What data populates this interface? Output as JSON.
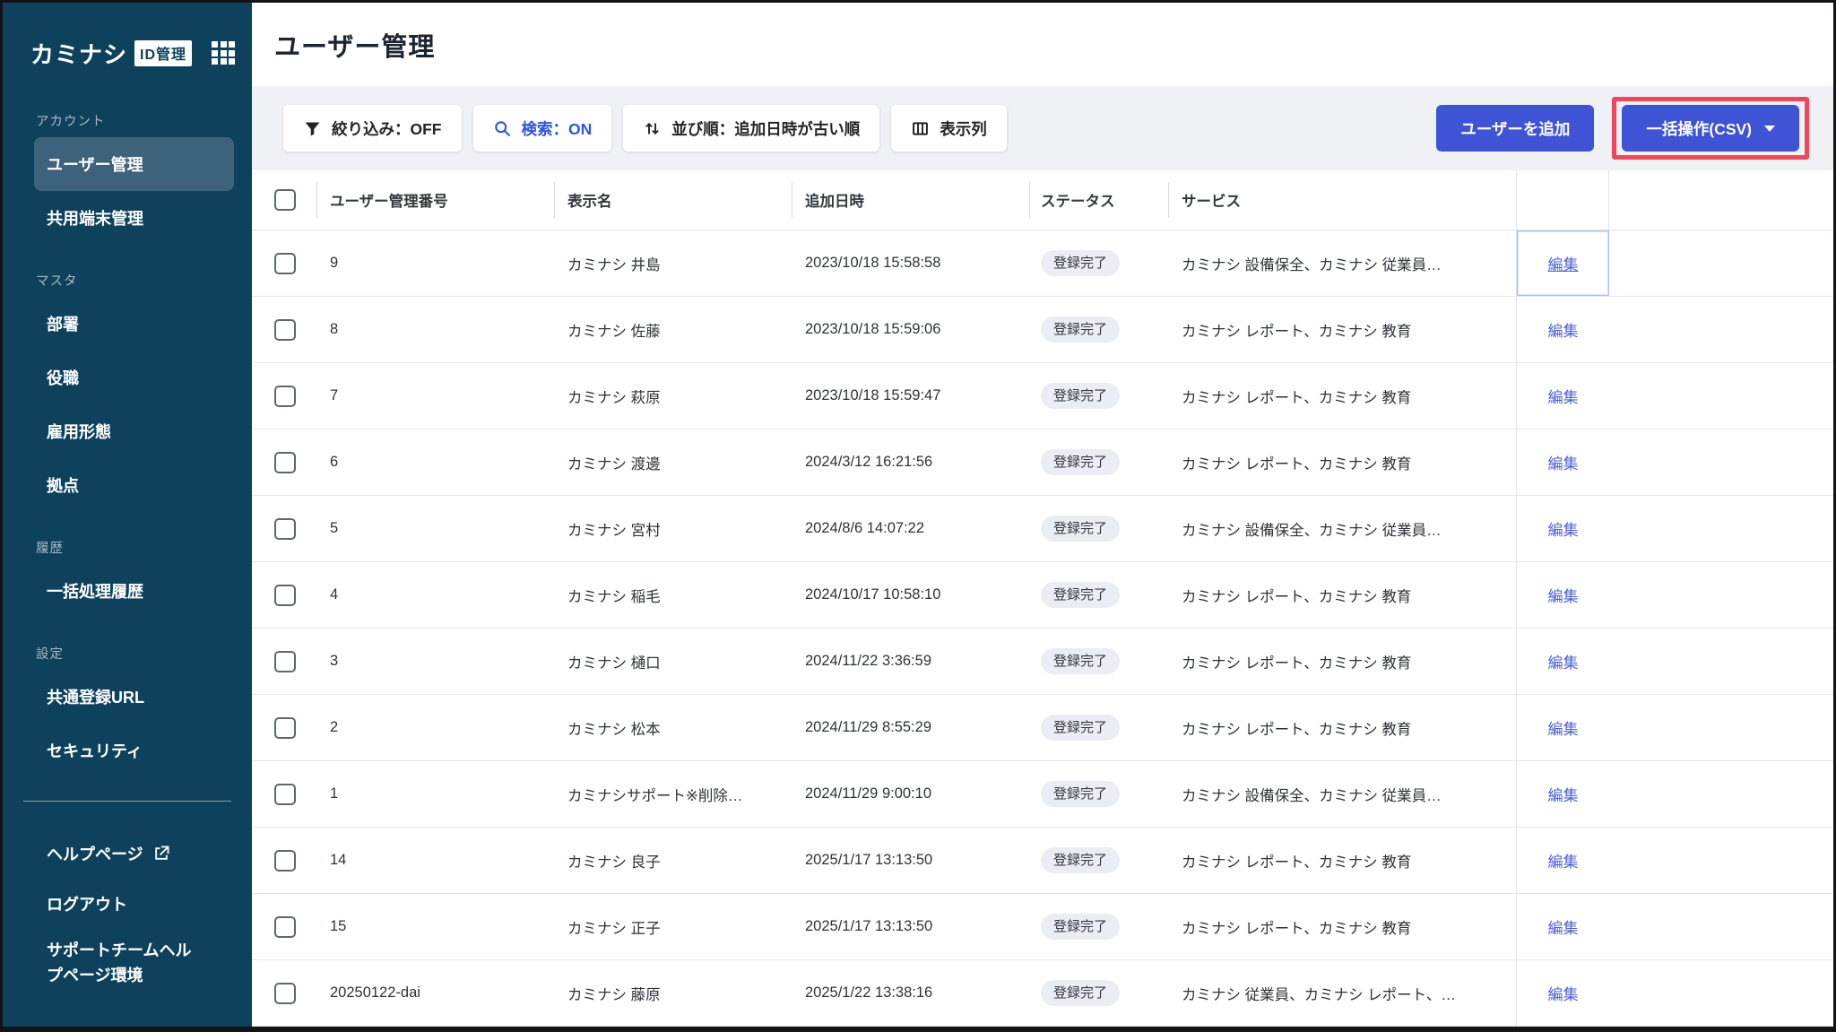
{
  "sidebar": {
    "logo_text": "カミナシ",
    "logo_badge": "ID管理",
    "sections": [
      {
        "label": "アカウント",
        "items": [
          {
            "label": "ユーザー管理",
            "active": true
          },
          {
            "label": "共用端末管理"
          }
        ]
      },
      {
        "label": "マスタ",
        "items": [
          {
            "label": "部署"
          },
          {
            "label": "役職"
          },
          {
            "label": "雇用形態"
          },
          {
            "label": "拠点"
          }
        ]
      },
      {
        "label": "履歴",
        "items": [
          {
            "label": "一括処理履歴"
          }
        ]
      },
      {
        "label": "設定",
        "items": [
          {
            "label": "共通登録URL"
          },
          {
            "label": "セキュリティ"
          }
        ]
      }
    ],
    "footer_items": [
      {
        "label": "ヘルプページ",
        "external": true
      },
      {
        "label": "ログアウト"
      },
      {
        "label": "サポートチームヘルプページ環境"
      }
    ]
  },
  "header": {
    "title": "ユーザー管理"
  },
  "toolbar": {
    "filter_button": "絞り込み：OFF",
    "search_button": "検索：ON",
    "sort_button": "並び順：追加日時が古い順",
    "columns_button": "表示列",
    "add_user_button": "ユーザーを追加",
    "bulk_button": "一括操作(CSV)"
  },
  "table": {
    "headers": [
      "ユーザー管理番号",
      "表示名",
      "追加日時",
      "ステータス",
      "サービス"
    ],
    "edit_label": "編集",
    "rows": [
      {
        "id": "9",
        "name": "カミナシ 井島",
        "added": "2023/10/18 15:58:58",
        "status": "登録完了",
        "services": "カミナシ 設備保全、カミナシ 従業員…",
        "focused": true
      },
      {
        "id": "8",
        "name": "カミナシ 佐藤",
        "added": "2023/10/18 15:59:06",
        "status": "登録完了",
        "services": "カミナシ レポート、カミナシ 教育"
      },
      {
        "id": "7",
        "name": "カミナシ 萩原",
        "added": "2023/10/18 15:59:47",
        "status": "登録完了",
        "services": "カミナシ レポート、カミナシ 教育"
      },
      {
        "id": "6",
        "name": "カミナシ 渡邊",
        "added": "2024/3/12 16:21:56",
        "status": "登録完了",
        "services": "カミナシ レポート、カミナシ 教育"
      },
      {
        "id": "5",
        "name": "カミナシ 宮村",
        "added": "2024/8/6 14:07:22",
        "status": "登録完了",
        "services": "カミナシ 設備保全、カミナシ 従業員…"
      },
      {
        "id": "4",
        "name": "カミナシ 稲毛",
        "added": "2024/10/17 10:58:10",
        "status": "登録完了",
        "services": "カミナシ レポート、カミナシ 教育"
      },
      {
        "id": "3",
        "name": "カミナシ 樋口",
        "added": "2024/11/22 3:36:59",
        "status": "登録完了",
        "services": "カミナシ レポート、カミナシ 教育"
      },
      {
        "id": "2",
        "name": "カミナシ 松本",
        "added": "2024/11/29 8:55:29",
        "status": "登録完了",
        "services": "カミナシ レポート、カミナシ 教育"
      },
      {
        "id": "1",
        "name": "カミナシサポート※削除…",
        "added": "2024/11/29 9:00:10",
        "status": "登録完了",
        "services": "カミナシ 設備保全、カミナシ 従業員…"
      },
      {
        "id": "14",
        "name": "カミナシ 良子",
        "added": "2025/1/17 13:13:50",
        "status": "登録完了",
        "services": "カミナシ レポート、カミナシ 教育"
      },
      {
        "id": "15",
        "name": "カミナシ 正子",
        "added": "2025/1/17 13:13:50",
        "status": "登録完了",
        "services": "カミナシ レポート、カミナシ 教育"
      },
      {
        "id": "20250122-dai",
        "name": "カミナシ 藤原",
        "added": "2025/1/22 13:38:16",
        "status": "登録完了",
        "services": "カミナシ 従業員、カミナシ レポート、…"
      }
    ]
  },
  "colors": {
    "sidebar_bg": "#0E425C",
    "sidebar_active_bg": "#3E627B",
    "primary_blue": "#3E53D6",
    "search_on_blue": "#2D55E2",
    "link_blue": "#4A5FD9",
    "annotation_red": "#F2455A",
    "toolbar_bg": "#F0F1F5",
    "badge_bg": "#EBEDF4"
  }
}
